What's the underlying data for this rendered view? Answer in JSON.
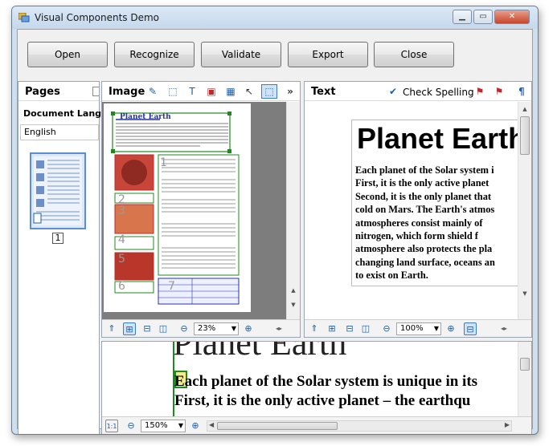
{
  "window": {
    "title": "Visual Components Demo"
  },
  "toolbar": {
    "open": "Open",
    "recognize": "Recognize",
    "validate": "Validate",
    "export": "Export",
    "close": "Close"
  },
  "pages": {
    "title": "Pages",
    "doc_lang_label": "Document Langu",
    "language": "English",
    "page_number": "1"
  },
  "image": {
    "title": "Image",
    "zoom": "23%",
    "block_numbers": [
      "1",
      "2",
      "3",
      "4",
      "5",
      "6",
      "7"
    ],
    "heading_text": "Planet Earth"
  },
  "text": {
    "title": "Text",
    "check_spelling": "Check Spelling",
    "zoom": "100%",
    "heading": "Planet Earth",
    "lines": [
      "Each planet of the Solar system i",
      "First, it is the only active planet",
      "Second, it is the only planet that",
      "cold on Mars. The Earth's atmos",
      "atmospheres consist mainly of",
      "nitrogen, which form shield f",
      "atmosphere also protects the pla",
      "changing land surface, oceans an",
      "to exist on Earth."
    ]
  },
  "zoomview": {
    "zoom": "150%",
    "heading": "Planet Earth",
    "lines": [
      "Each planet of the Solar system is unique in its",
      "First, it is the only active planet – the earthqu"
    ]
  },
  "colors": {
    "titlebar": "#c6d8ec",
    "accent": "#1c5fa8",
    "block_green": "#1e8a1e",
    "block_red": "#c0292b",
    "block_blue": "#2233aa"
  }
}
